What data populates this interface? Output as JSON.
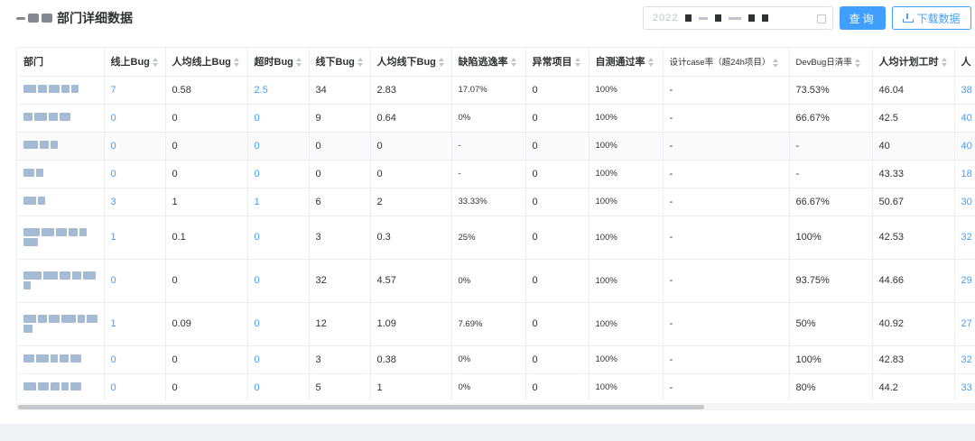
{
  "header": {
    "title": "部门详细数据",
    "date_picker": {
      "value": "2022"
    },
    "query_label": "查询",
    "download_label": "下载数据"
  },
  "table": {
    "columns": [
      "部门",
      "线上Bug",
      "人均线上Bug",
      "超时Bug",
      "线下Bug",
      "人均线下Bug",
      "缺陷逃逸率",
      "异常项目",
      "自测通过率",
      "设计case率（超24h项目）",
      "DevBug日清率",
      "人均计划工时",
      "人"
    ],
    "rows": [
      [
        "7",
        "0.58",
        "2.5",
        "34",
        "2.83",
        "17.07%",
        "0",
        "100%",
        "-",
        "73.53%",
        "46.04",
        "38"
      ],
      [
        "0",
        "0",
        "0",
        "9",
        "0.64",
        "0%",
        "0",
        "100%",
        "-",
        "66.67%",
        "42.5",
        "40"
      ],
      [
        "0",
        "0",
        "0",
        "0",
        "0",
        "-",
        "0",
        "100%",
        "-",
        "-",
        "40",
        "40"
      ],
      [
        "0",
        "0",
        "0",
        "0",
        "0",
        "-",
        "0",
        "100%",
        "-",
        "-",
        "43.33",
        "18"
      ],
      [
        "3",
        "1",
        "1",
        "6",
        "2",
        "33.33%",
        "0",
        "100%",
        "-",
        "66.67%",
        "50.67",
        "30"
      ],
      [
        "1",
        "0.1",
        "0",
        "3",
        "0.3",
        "25%",
        "0",
        "100%",
        "-",
        "100%",
        "42.53",
        "32"
      ],
      [
        "0",
        "0",
        "0",
        "32",
        "4.57",
        "0%",
        "0",
        "100%",
        "-",
        "93.75%",
        "44.66",
        "29"
      ],
      [
        "1",
        "0.09",
        "0",
        "12",
        "1.09",
        "7.69%",
        "0",
        "100%",
        "-",
        "50%",
        "40.92",
        "27"
      ],
      [
        "0",
        "0",
        "0",
        "3",
        "0.38",
        "0%",
        "0",
        "100%",
        "-",
        "100%",
        "42.83",
        "32"
      ],
      [
        "0",
        "0",
        "0",
        "5",
        "1",
        "0%",
        "0",
        "100%",
        "-",
        "80%",
        "44.2",
        "33"
      ]
    ]
  },
  "colors": {
    "primary": "#409eff",
    "text": "#303133",
    "border": "#ebeef5"
  }
}
